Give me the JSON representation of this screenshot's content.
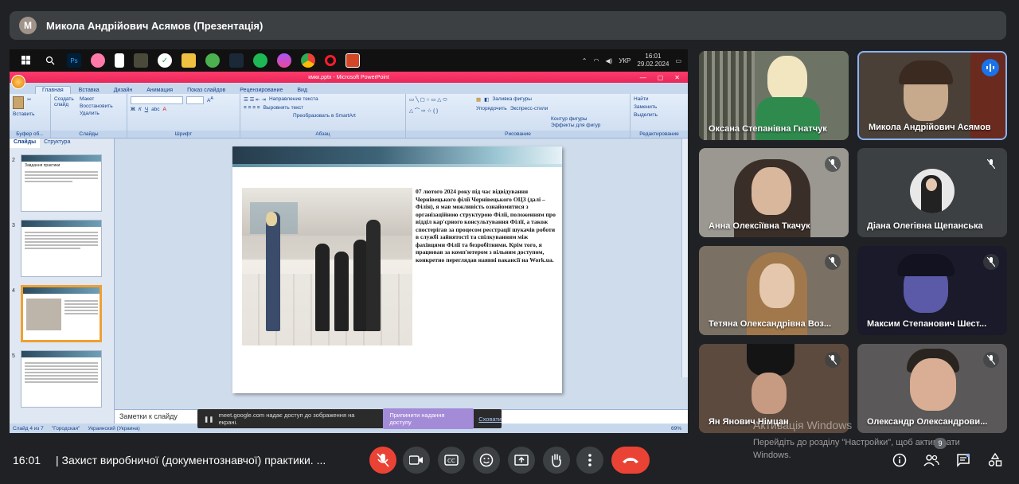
{
  "presenter": {
    "avatar_letter": "M",
    "title": "Микола Андрійович Асямов (Презентація)"
  },
  "taskbar": {
    "lang": "УКР",
    "time": "16:01",
    "date": "29.02.2024"
  },
  "ppt": {
    "window_title": "кмкк.pptx - Microsoft PowerPoint",
    "tabs": [
      "Главная",
      "Вставка",
      "Дизайн",
      "Анимация",
      "Показ слайдов",
      "Рецензирование",
      "Вид"
    ],
    "groups": {
      "clipboard": "Буфер об...",
      "slides": "Слайды",
      "font": "Шрифт",
      "paragraph": "Абзац",
      "drawing": "Рисование",
      "editing": "Редактирование"
    },
    "buttons": {
      "paste": "Вставить",
      "create_slide": "Создать слайд",
      "layout": "Макет",
      "restore": "Восстановить",
      "delete": "Удалить",
      "text_direction": "Направление текста",
      "align_text": "Выровнять текст",
      "smartart": "Преобразовать в SmartArt",
      "arrange": "Упорядочить",
      "quick_styles": "Экспресс-стили",
      "shape_fill": "Заливка фигуры",
      "shape_outline": "Контур фигуры",
      "shape_effects": "Эффекты для фигур",
      "find": "Найти",
      "replace": "Заменить",
      "select": "Выделить"
    },
    "pane_tabs": [
      "Слайды",
      "Структура"
    ],
    "thumbnails": [
      {
        "num": "2",
        "title": "Завдання практики"
      },
      {
        "num": "3",
        "title": ""
      },
      {
        "num": "4",
        "title": ""
      },
      {
        "num": "5",
        "title": ""
      }
    ],
    "slide_text": "07 лютого 2024 року  під час відвідування Чернівецького філії Чернівецького ОЦЗ (далі – Філія), я мав можливість ознайомитися з організаційною структурою Філії, положенням про відділ кар'єрного консультування Філії, а також спостерігав за процесом реєстрації шукачів роботи в службі зайнятості та спілкуванням між фахівцями Філії та безробітними. Крім того, я працював за комп'ютером з вільним доступом, конкретно переглядав наявні вакансії на Work.ua.",
    "notes_placeholder": "Заметки к слайду",
    "status": {
      "slide": "Слайд 4 из 7",
      "theme": "\"Городская\"",
      "lang": "Украинский (Украина)",
      "zoom": "69%"
    }
  },
  "share_notice": {
    "text": "meet.google.com надає доступ до зображення на екрані.",
    "stop": "Припинити надання доступу",
    "hide": "Сховати"
  },
  "participants": [
    {
      "name": "Оксана Степанівна Гнатчук",
      "muted": false
    },
    {
      "name": "Микола Андрійович Асямов",
      "speaking": true
    },
    {
      "name": "Анна Олексіївна Ткачук",
      "muted": true
    },
    {
      "name": "Діана Олегівна Щепанська",
      "muted": true
    },
    {
      "name": "Тетяна Олександрівна Воз...",
      "muted": true
    },
    {
      "name": "Максим Степанович Шест...",
      "muted": true
    },
    {
      "name": "Ян Янович Німцан",
      "muted": true
    },
    {
      "name": "Олександр Олександрови...",
      "muted": true
    }
  ],
  "bottom": {
    "time": "16:01",
    "meeting_title": "Захист виробничої (документознавчої) практики. ...",
    "participant_count": "9"
  },
  "watermark": {
    "title": "Активація Windows",
    "subtitle": "Перейдіть до розділу \"Настройки\", щоб активувати Windows."
  },
  "colors": {
    "accent_red": "#ea4335",
    "accent_blue": "#8ab4f8",
    "background": "#202124"
  }
}
